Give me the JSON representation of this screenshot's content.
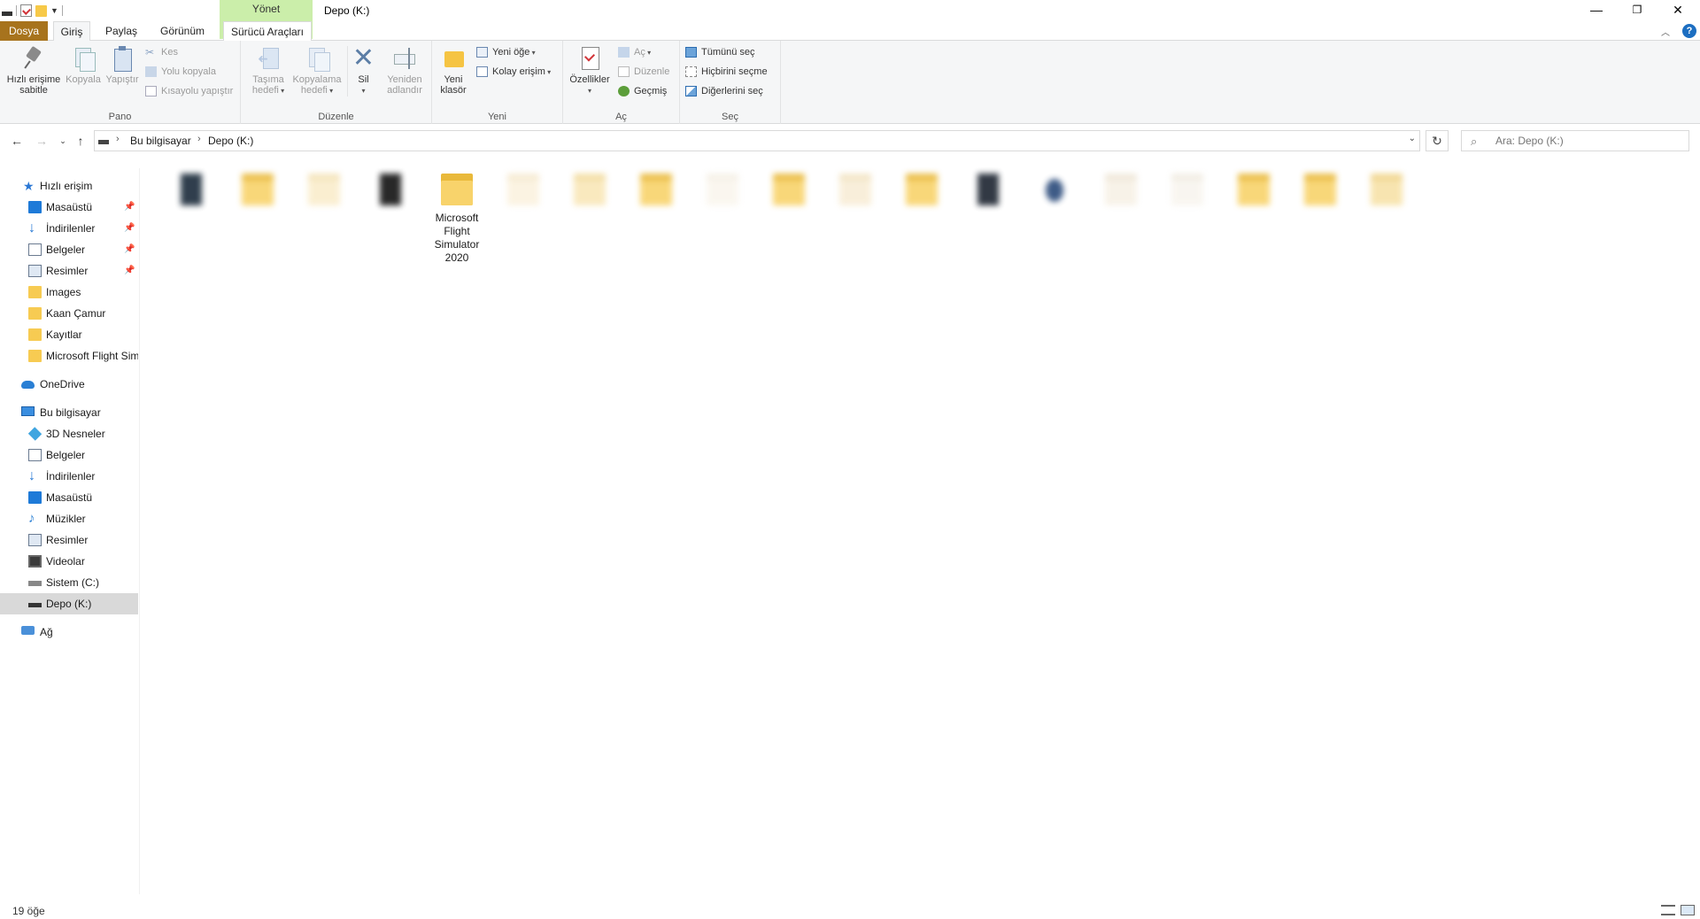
{
  "window": {
    "title": "Depo (K:)",
    "context_tab_group": "Yönet",
    "minimize": "—",
    "restore": "❐",
    "close": "✕"
  },
  "tabs": {
    "dosya": "Dosya",
    "giris": "Giriş",
    "paylas": "Paylaş",
    "gorunum": "Görünüm",
    "surucu": "Sürücü Araçları",
    "help": "?"
  },
  "ribbon": {
    "pano": {
      "label": "Pano",
      "pin": [
        "Hızlı erişime",
        "sabitle"
      ],
      "copy": "Kopyala",
      "paste": "Yapıştır",
      "cut": "Kes",
      "copy_path": "Yolu kopyala",
      "paste_shortcut": "Kısayolu yapıştır"
    },
    "duzenle": {
      "label": "Düzenle",
      "move_to": [
        "Taşıma",
        "hedefi"
      ],
      "copy_to": [
        "Kopyalama",
        "hedefi"
      ],
      "delete": "Sil",
      "rename": [
        "Yeniden",
        "adlandır"
      ]
    },
    "yeni": {
      "label": "Yeni",
      "new_folder": [
        "Yeni",
        "klasör"
      ],
      "new_item": "Yeni öğe",
      "easy_access": "Kolay erişim"
    },
    "ac": {
      "label": "Aç",
      "properties": "Özellikler",
      "open": "Aç",
      "edit": "Düzenle",
      "history": "Geçmiş"
    },
    "sec": {
      "label": "Seç",
      "select_all": "Tümünü seç",
      "select_none": "Hiçbirini seçme",
      "invert": "Diğerlerini seç"
    }
  },
  "address": {
    "crumbs": [
      "Bu bilgisayar",
      "Depo (K:)"
    ],
    "search_placeholder": "Ara: Depo (K:)"
  },
  "nav": {
    "quick_access": "Hızlı erişim",
    "quick_items": [
      "Masaüstü",
      "İndirilenler",
      "Belgeler",
      "Resimler",
      "Images",
      "Kaan Çamur",
      "Kayıtlar",
      "Microsoft Flight Sim"
    ],
    "onedrive": "OneDrive",
    "this_pc": "Bu bilgisayar",
    "pc_items": [
      "3D Nesneler",
      "Belgeler",
      "İndirilenler",
      "Masaüstü",
      "Müzikler",
      "Resimler",
      "Videolar",
      "Sistem (C:)",
      "Depo (K:)"
    ],
    "network": "Ağ"
  },
  "files": {
    "visible_item": [
      "Microsoft",
      "Flight",
      "Simulator",
      "2020"
    ]
  },
  "status": {
    "count": "19 öğe"
  }
}
